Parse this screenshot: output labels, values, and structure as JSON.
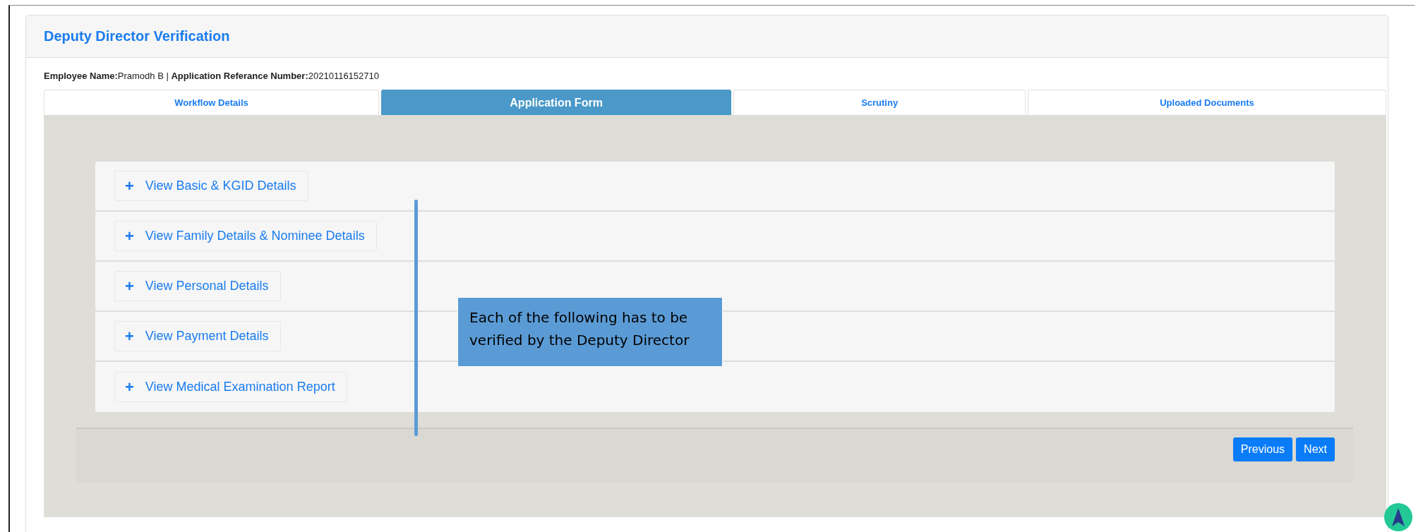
{
  "panel": {
    "title": "Deputy Director Verification"
  },
  "employee_line": "**Employee Name:**Pramodh B | **Application Referance Number:**20210116152710",
  "tabs": [
    {
      "label": "Workflow Details",
      "selected": false
    },
    {
      "label": "Application Form",
      "selected": true
    },
    {
      "label": "Scrutiny",
      "selected": false
    },
    {
      "label": "Uploaded Documents",
      "selected": false
    }
  ],
  "sections": [
    {
      "icon": "+",
      "label": "View Basic & KGID Details"
    },
    {
      "icon": "+",
      "label": "View Family Details & Nominee Details"
    },
    {
      "icon": "+",
      "label": "View Personal Details"
    },
    {
      "icon": "+",
      "label": "View Payment Details"
    },
    {
      "icon": "+",
      "label": "View Medical Examination Report"
    }
  ],
  "buttons": [
    "Previous",
    "Next"
  ],
  "annotation": {
    "text": "Each of the following has to be verified by the Deputy Director"
  }
}
